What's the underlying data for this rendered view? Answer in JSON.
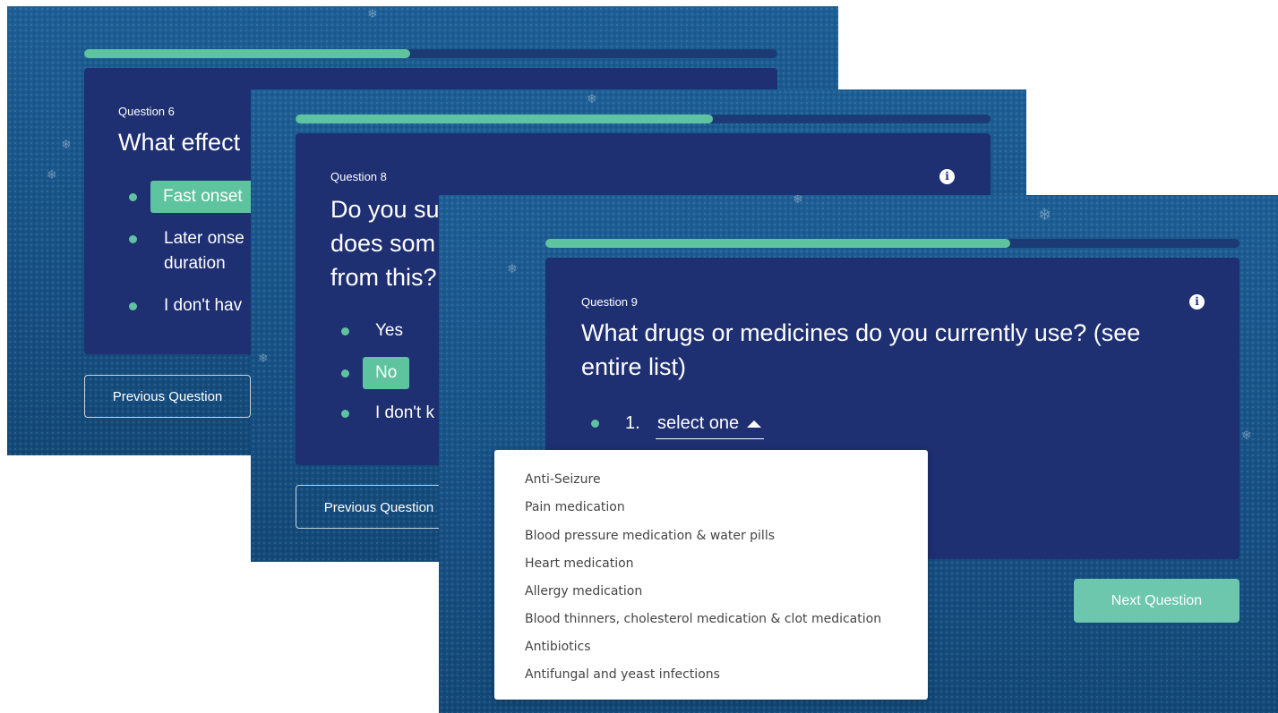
{
  "screens": {
    "q6": {
      "question_number": "Question 6",
      "question_text": "What effect",
      "options": [
        {
          "label": "Fast onset",
          "selected": true
        },
        {
          "label": "Later onse\nduration",
          "selected": false
        },
        {
          "label": "I don't hav",
          "selected": false
        }
      ],
      "previous_button": "Previous Question",
      "progress": 0.47
    },
    "q8": {
      "question_number": "Question 8",
      "question_lines": [
        "Do you su",
        "does som",
        "from this?"
      ],
      "options": [
        {
          "label": "Yes",
          "selected": false
        },
        {
          "label": "No",
          "selected": true
        },
        {
          "label": "I don't k",
          "selected": false
        }
      ],
      "previous_button": "Previous Question",
      "info_icon": "info-icon",
      "progress": 0.6
    },
    "q9": {
      "question_number": "Question 9",
      "question_text": "What drugs or medicines do you currently use? (see entire list)",
      "select_index": "1.",
      "select_placeholder": "select one",
      "caret_icon": "caret-up-icon",
      "dropdown_options": [
        "Anti-Seizure",
        "Pain medication",
        "Blood pressure medication & water pills",
        "Heart medication",
        "Allergy medication",
        "Blood thinners, cholesterol medication & clot medication",
        "Antibiotics",
        "Antifungal and yeast infections"
      ],
      "next_button": "Next Question",
      "info_icon": "info-icon",
      "progress": 0.67
    }
  },
  "colors": {
    "background": "#1a5a8e",
    "card": "#1e2f72",
    "accent": "#5ec49f",
    "next_button": "#6cc7ac"
  }
}
